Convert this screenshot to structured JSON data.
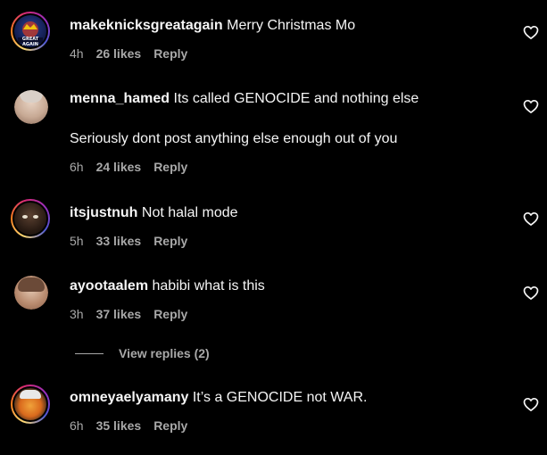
{
  "comments": [
    {
      "username": "makeknicksgreatagain",
      "text": "Merry Christmas Mo",
      "time": "4h",
      "likes": "26 likes",
      "reply": "Reply",
      "avatar_text": "GREAT AGAIN"
    },
    {
      "username": "menna_hamed",
      "text": "Its called GENOCIDE and nothing else",
      "text2": "Seriously dont post anything else enough out of you",
      "time": "6h",
      "likes": "24 likes",
      "reply": "Reply"
    },
    {
      "username": "itsjustnuh",
      "text": "Not halal mode",
      "time": "5h",
      "likes": "33 likes",
      "reply": "Reply"
    },
    {
      "username": "ayootaalem",
      "text": "habibi what is this",
      "time": "3h",
      "likes": "37 likes",
      "reply": "Reply"
    },
    {
      "username": "omneyaelyamany",
      "text": "It’s a GENOCIDE not WAR.",
      "time": "6h",
      "likes": "35 likes",
      "reply": "Reply"
    }
  ],
  "view_replies": "View replies (2)",
  "icons": {
    "like": "heart-outline-icon"
  },
  "colors": {
    "background": "#000000",
    "primary_text": "#f5f5f5",
    "secondary_text": "#a8a8a8"
  }
}
